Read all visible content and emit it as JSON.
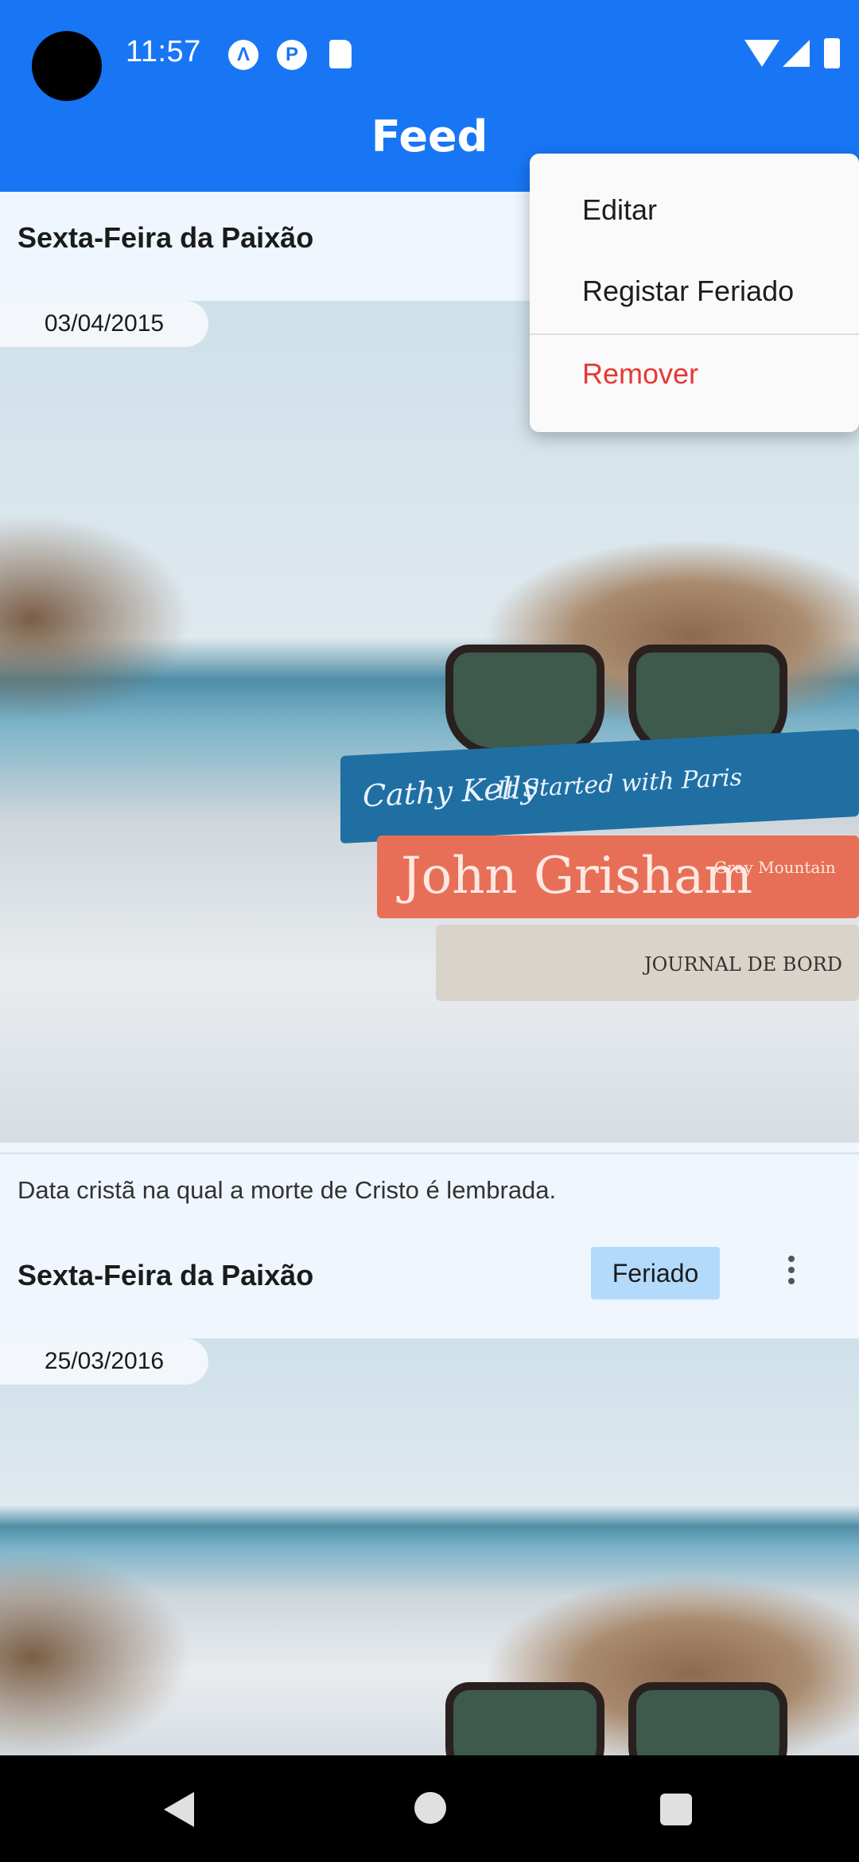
{
  "status_bar": {
    "time": "11:57",
    "notification_icons": [
      "a-logo-icon",
      "p-logo-icon",
      "sd-card-icon"
    ],
    "wifi": "wifi-icon",
    "signal": "signal-icon",
    "battery": "battery-icon"
  },
  "header": {
    "title": "Feed",
    "background": "#1876f5"
  },
  "feed": [
    {
      "title": "Sexta-Feira da Paixão",
      "date": "03/04/2015",
      "description": "Data cristã na qual a morte de Cristo é lembrada.",
      "image": "beach-books-sunglasses"
    },
    {
      "title": "Sexta-Feira da Paixão",
      "date": "25/03/2016",
      "tag": "Feriado",
      "image": "beach-books-sunglasses"
    }
  ],
  "book_spines": {
    "top": [
      "Cathy Kelly",
      "It Started with Paris"
    ],
    "middle": [
      "John Grisham",
      "Gray Mountain"
    ],
    "bottom": [
      "JOURNAL DE BORD"
    ]
  },
  "context_menu": {
    "items": [
      "Editar",
      "Registar Feriado"
    ],
    "danger_item": "Remover",
    "danger_color": "#e53935"
  },
  "nav_bar": {
    "buttons": [
      "back-icon",
      "home-icon",
      "recents-icon"
    ]
  }
}
